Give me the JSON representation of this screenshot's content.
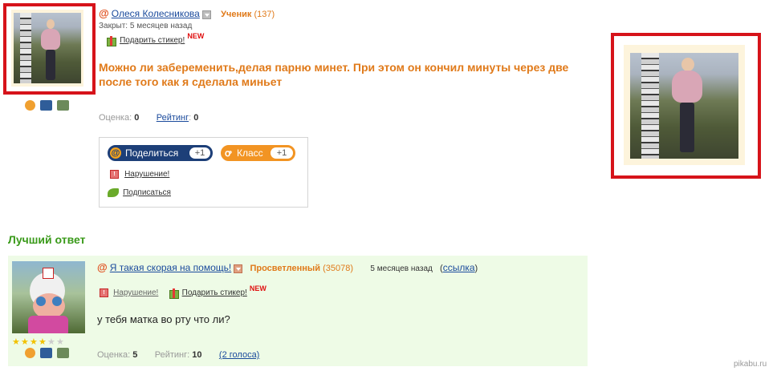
{
  "question": {
    "user_name": "Олеся Колесникова",
    "rank": "Ученик",
    "rank_points": "(137)",
    "closed": "Закрыт: 5 месяцев назад",
    "gift_sticker": "Подарить стикер!",
    "new_badge": "NEW",
    "title": "Можно ли забеременить,делая парню минет. При этом он кончил минуты через две после того как я сделала миньет",
    "score_label": "Оценка:",
    "score_value": "0",
    "rating_label": "Рейтинг",
    "rating_value": "0"
  },
  "share": {
    "share_label": "Поделиться",
    "share_count": "+1",
    "ok_label": "Класс",
    "ok_count": "+1",
    "violation": "Нарушение!",
    "subscribe": "Подписаться"
  },
  "best_answer": {
    "heading": "Лучший ответ",
    "user_name": "Я такая скорая на помощь!",
    "rank": "Просветленный",
    "rank_points": "(35078)",
    "time": "5 месяцев назад",
    "link_open": "(",
    "link_label": "ссылка",
    "link_close": ")",
    "violation": "Нарушение!",
    "gift_sticker": "Подарить стикер!",
    "new_badge": "NEW",
    "text": "у тебя матка во рту что ли?",
    "score_label": "Оценка:",
    "score_value": "5",
    "rating_label": "Рейтинг:",
    "rating_value": "10",
    "votes": "(2 голоса)",
    "stars_filled": 4,
    "stars_total": 6
  },
  "watermark": "pikabu.ru",
  "colors": {
    "highlight_frame": "#d6131a",
    "accent_orange": "#e07a1a",
    "heading_green": "#3a9a1a",
    "answer_bg": "#eefbe6"
  }
}
